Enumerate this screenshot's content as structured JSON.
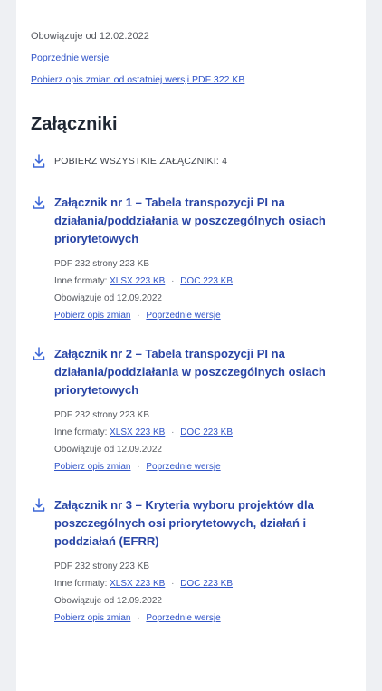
{
  "colors": {
    "background": "#eef0f3",
    "panel": "#ffffff",
    "title": "#1f2733",
    "attachment_title": "#2a46a6",
    "link": "#2f53c8",
    "muted": "#55585f",
    "icon": "#3b66d6"
  },
  "document": {
    "valid_from": "Obowiązuje od 12.02.2022",
    "previous_versions": "Poprzednie wersje",
    "download_changes": "Pobierz opis zmian od ostatniej wersji PDF 322 KB"
  },
  "attachments_section": {
    "title": "Załączniki",
    "download_all_label": "POBIERZ WSZYSTKIE ZAŁĄCZNIKI: 4",
    "download_icon": "download-icon",
    "items": [
      {
        "title": "Załącznik nr 1 – Tabela transpozycji PI na działania/poddziałania w poszczególnych osiach priorytetowych",
        "size_info": "PDF 232 strony 223 KB",
        "other_formats_label": "Inne formaty:",
        "format_xlsx": "XLSX 223 KB",
        "format_doc": "DOC 223 KB",
        "valid_from": "Obowiązuje od 12.09.2022",
        "changes_link": "Pobierz opis zmian",
        "versions_link": "Poprzednie wersje"
      },
      {
        "title": "Załącznik nr 2 – Tabela transpozycji PI na działania/poddziałania w poszczególnych osiach priorytetowych",
        "size_info": "PDF 232 strony 223 KB",
        "other_formats_label": "Inne formaty:",
        "format_xlsx": "XLSX 223 KB",
        "format_doc": "DOC 223 KB",
        "valid_from": "Obowiązuje od 12.09.2022",
        "changes_link": "Pobierz opis zmian",
        "versions_link": "Poprzednie wersje"
      },
      {
        "title": "Załącznik nr 3 – Kryteria wyboru projektów dla poszczególnych osi priorytetowych, działań i poddziałań (EFRR)",
        "size_info": "PDF 232 strony 223 KB",
        "other_formats_label": "Inne formaty:",
        "format_xlsx": "XLSX 223 KB",
        "format_doc": "DOC 223 KB",
        "valid_from": "Obowiązuje od 12.09.2022",
        "changes_link": "Pobierz opis zmian",
        "versions_link": "Poprzednie wersje"
      }
    ]
  }
}
